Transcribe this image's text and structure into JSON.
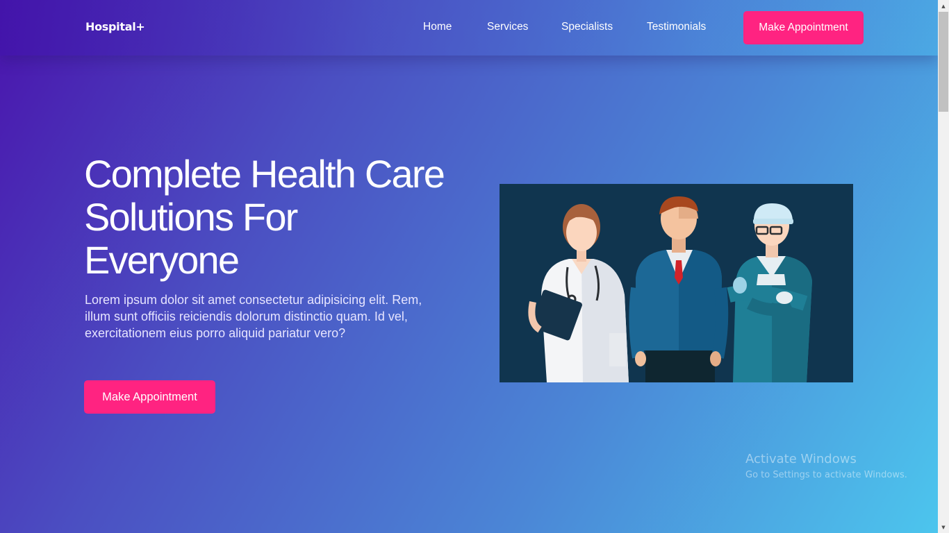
{
  "nav": {
    "brand": "Hospital+",
    "links": [
      "Home",
      "Services",
      "Specialists",
      "Testimonials"
    ],
    "cta": "Make Appointment"
  },
  "hero": {
    "title": "Complete Health Care Solutions For Everyone",
    "text": "Lorem ipsum dolor sit amet consectetur adipisicing elit. Rem, illum sunt officiis reiciendis dolorum distinctio quam. Id vel, exercitationem eius porro aliquid pariatur vero?",
    "cta": "Make Appointment",
    "image_icon": "doctors-illustration"
  },
  "watermark": {
    "title": "Activate Windows",
    "subtitle": "Go to Settings to activate Windows."
  },
  "colors": {
    "accent": "#ff2381",
    "gradient_start": "#4a14ad",
    "gradient_end": "#4cc7ee",
    "image_bg": "#10354f"
  }
}
